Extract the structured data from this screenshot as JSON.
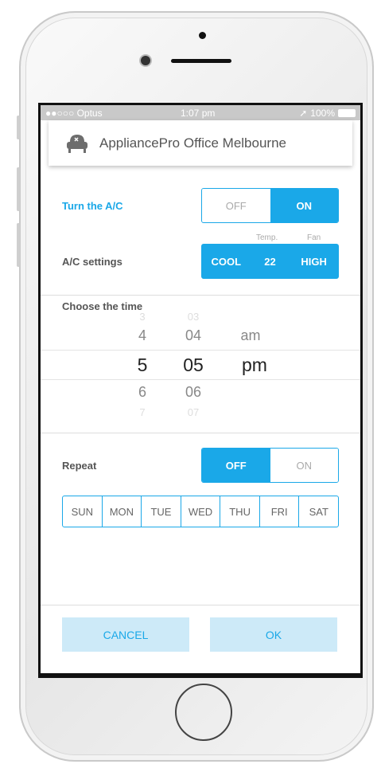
{
  "status_bar": {
    "carrier": "●●○○○ Optus",
    "time": "1:07 pm",
    "battery": "100%"
  },
  "header": {
    "title": "AppliancePro Office Melbourne",
    "icon": "armchair-icon"
  },
  "ac_power": {
    "label": "Turn the A/C",
    "off": "OFF",
    "on": "ON",
    "selected": "ON"
  },
  "ac_settings": {
    "label": "A/C settings",
    "temp_caption": "Temp.",
    "fan_caption": "Fan",
    "mode": "COOL",
    "temp": "22",
    "fan": "HIGH"
  },
  "time_picker": {
    "label": "Choose the time",
    "hours": [
      "3",
      "4",
      "5",
      "6",
      "7"
    ],
    "minutes": [
      "03",
      "04",
      "05",
      "06",
      "07"
    ],
    "periods": [
      "am",
      "pm"
    ],
    "selected": {
      "hour": "5",
      "minute": "05",
      "period": "pm"
    }
  },
  "repeat": {
    "label": "Repeat",
    "off": "OFF",
    "on": "ON",
    "selected": "OFF"
  },
  "days": [
    "SUN",
    "MON",
    "TUE",
    "WED",
    "THU",
    "FRI",
    "SAT"
  ],
  "buttons": {
    "cancel": "CANCEL",
    "ok": "OK"
  },
  "colors": {
    "accent": "#1aa8e8",
    "button_bg": "#cdeaf8"
  }
}
